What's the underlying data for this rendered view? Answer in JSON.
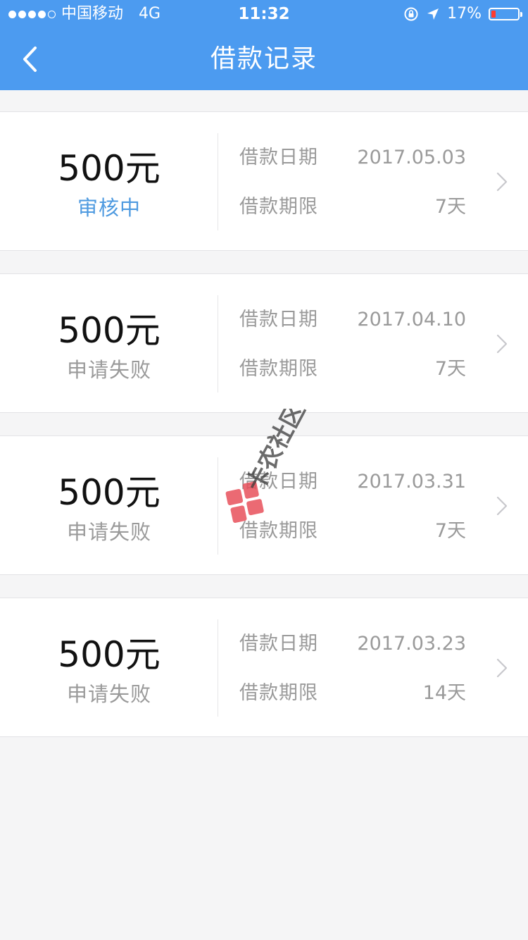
{
  "status_bar": {
    "carrier": "中国移动",
    "network": "4G",
    "time": "11:32",
    "battery": "17%",
    "battery_level": 0.17,
    "signal_bars": 4,
    "signal_max": 5
  },
  "nav": {
    "title": "借款记录",
    "back_icon": "chevron-left-icon"
  },
  "colors": {
    "header": "#4c9bf0",
    "pending": "#4e9ae0",
    "muted": "#9a9a9a",
    "battery_low": "#ff3b30"
  },
  "records": [
    {
      "amount": "500元",
      "status": "审核中",
      "status_type": "pending",
      "date_label": "借款日期",
      "date": "2017.05.03",
      "term_label": "借款期限",
      "term": "7天"
    },
    {
      "amount": "500元",
      "status": "申请失败",
      "status_type": "failed",
      "date_label": "借款日期",
      "date": "2017.04.10",
      "term_label": "借款期限",
      "term": "7天"
    },
    {
      "amount": "500元",
      "status": "申请失败",
      "status_type": "failed",
      "date_label": "借款日期",
      "date": "2017.03.31",
      "term_label": "借款期限",
      "term": "7天"
    },
    {
      "amount": "500元",
      "status": "申请失败",
      "status_type": "failed",
      "date_label": "借款日期",
      "date": "2017.03.23",
      "term_label": "借款期限",
      "term": "14天"
    }
  ],
  "watermark": {
    "text": "卡农社区"
  }
}
